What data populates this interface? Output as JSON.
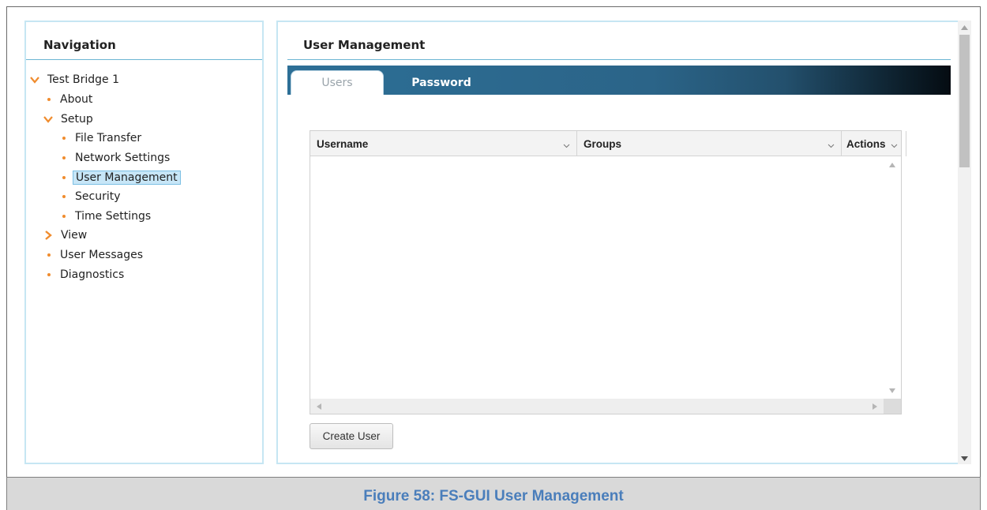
{
  "navigation": {
    "title": "Navigation",
    "items": [
      {
        "label": "Test Bridge 1",
        "type": "expanded"
      },
      {
        "label": "About",
        "type": "leaf"
      },
      {
        "label": "Setup",
        "type": "expanded"
      },
      {
        "label": "File Transfer",
        "type": "leaf"
      },
      {
        "label": "Network Settings",
        "type": "leaf"
      },
      {
        "label": "User Management",
        "type": "leaf",
        "selected": true
      },
      {
        "label": "Security",
        "type": "leaf"
      },
      {
        "label": "Time Settings",
        "type": "leaf"
      },
      {
        "label": "View",
        "type": "collapsed"
      },
      {
        "label": "User Messages",
        "type": "leaf"
      },
      {
        "label": "Diagnostics",
        "type": "leaf"
      }
    ]
  },
  "main": {
    "title": "User Management",
    "tabs": [
      {
        "label": "Users",
        "active": true
      },
      {
        "label": "Password",
        "active": false
      }
    ],
    "grid": {
      "columns": [
        "Username",
        "Groups",
        "Actions"
      ],
      "rows": []
    },
    "create_button": "Create User"
  },
  "caption": "Figure 58: FS-GUI User Management",
  "colors": {
    "accent_orange": "#f08c2e",
    "panel_border": "#c6e6f3",
    "tabbar_start": "#2d6f96",
    "tabbar_end": "#050c12",
    "caption_text": "#4a7ebb",
    "selection": "#c7e6f7"
  },
  "icons": {
    "expanded": "chevron-down-icon",
    "collapsed": "chevron-right-icon",
    "leaf": "bullet-icon",
    "sort": "sort-chevron-icon"
  }
}
